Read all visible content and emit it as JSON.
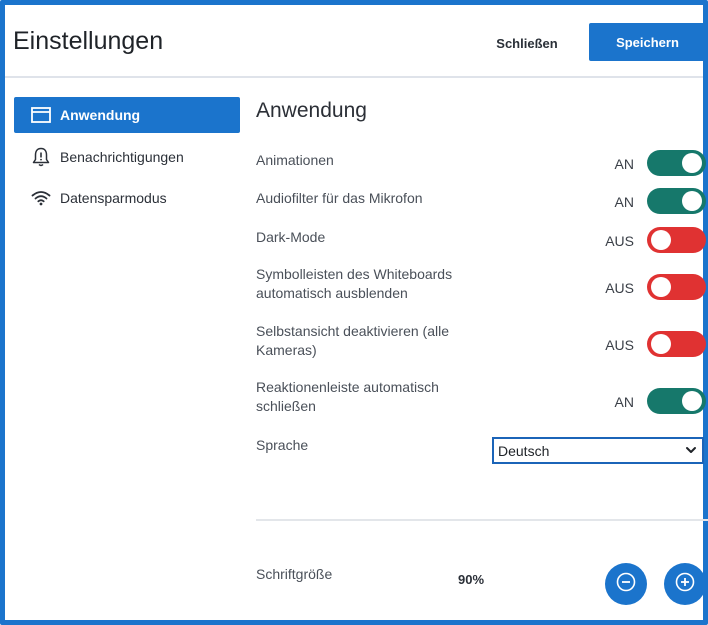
{
  "header": {
    "title": "Einstellungen",
    "close_label": "Schließen",
    "save_label": "Speichern"
  },
  "sidebar": {
    "items": [
      {
        "label": "Anwendung",
        "icon": "window-icon",
        "active": true
      },
      {
        "label": "Benachrichtigungen",
        "icon": "bell-alert-icon",
        "active": false
      },
      {
        "label": "Datensparmodus",
        "icon": "wifi-icon",
        "active": false
      }
    ]
  },
  "main": {
    "title": "Anwendung",
    "settings": [
      {
        "label": "Animationen",
        "state": "AN",
        "on": true
      },
      {
        "label": "Audiofilter für das Mikrofon",
        "state": "AN",
        "on": true
      },
      {
        "label": "Dark-Mode",
        "state": "AUS",
        "on": false
      },
      {
        "label": "Symbolleisten des Whiteboards automatisch ausblenden",
        "state": "AUS",
        "on": false
      },
      {
        "label": "Selbstansicht deaktivieren (alle Kameras)",
        "state": "AUS",
        "on": false
      },
      {
        "label": "Reaktionenleiste automatisch schließen",
        "state": "AN",
        "on": true
      }
    ],
    "language": {
      "label": "Sprache",
      "value": "Deutsch"
    },
    "font_size": {
      "label": "Schriftgröße",
      "value": "90%"
    }
  },
  "colors": {
    "accent": "#1b74cc",
    "toggle_on": "#16786b",
    "toggle_off": "#e03232"
  }
}
